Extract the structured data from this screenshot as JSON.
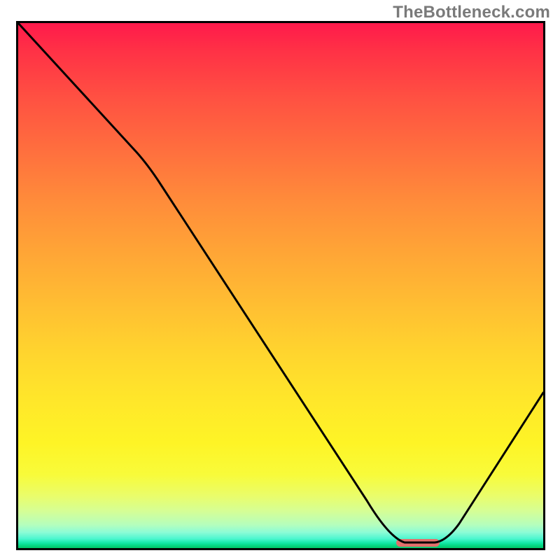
{
  "watermark": "TheBottleneck.com",
  "chart_data": {
    "type": "line",
    "title": "",
    "xlabel": "",
    "ylabel": "",
    "xlim": [
      0,
      100
    ],
    "ylim": [
      0,
      100
    ],
    "grid": false,
    "legend": false,
    "background_gradient": {
      "top": "#ff1a4b",
      "mid": "#ffd52e",
      "bottom": "#02c566"
    },
    "series": [
      {
        "name": "curve",
        "stroke": "#000000",
        "x": [
          0,
          22,
          26,
          66,
          72,
          78,
          81,
          100
        ],
        "values": [
          100,
          76,
          72,
          9,
          1,
          1,
          3,
          30
        ]
      }
    ],
    "marker": {
      "name": "highlight-segment",
      "color": "#e2706b",
      "x_start": 72,
      "x_end": 80,
      "y": 0.6,
      "height_pct": 1.4
    }
  }
}
